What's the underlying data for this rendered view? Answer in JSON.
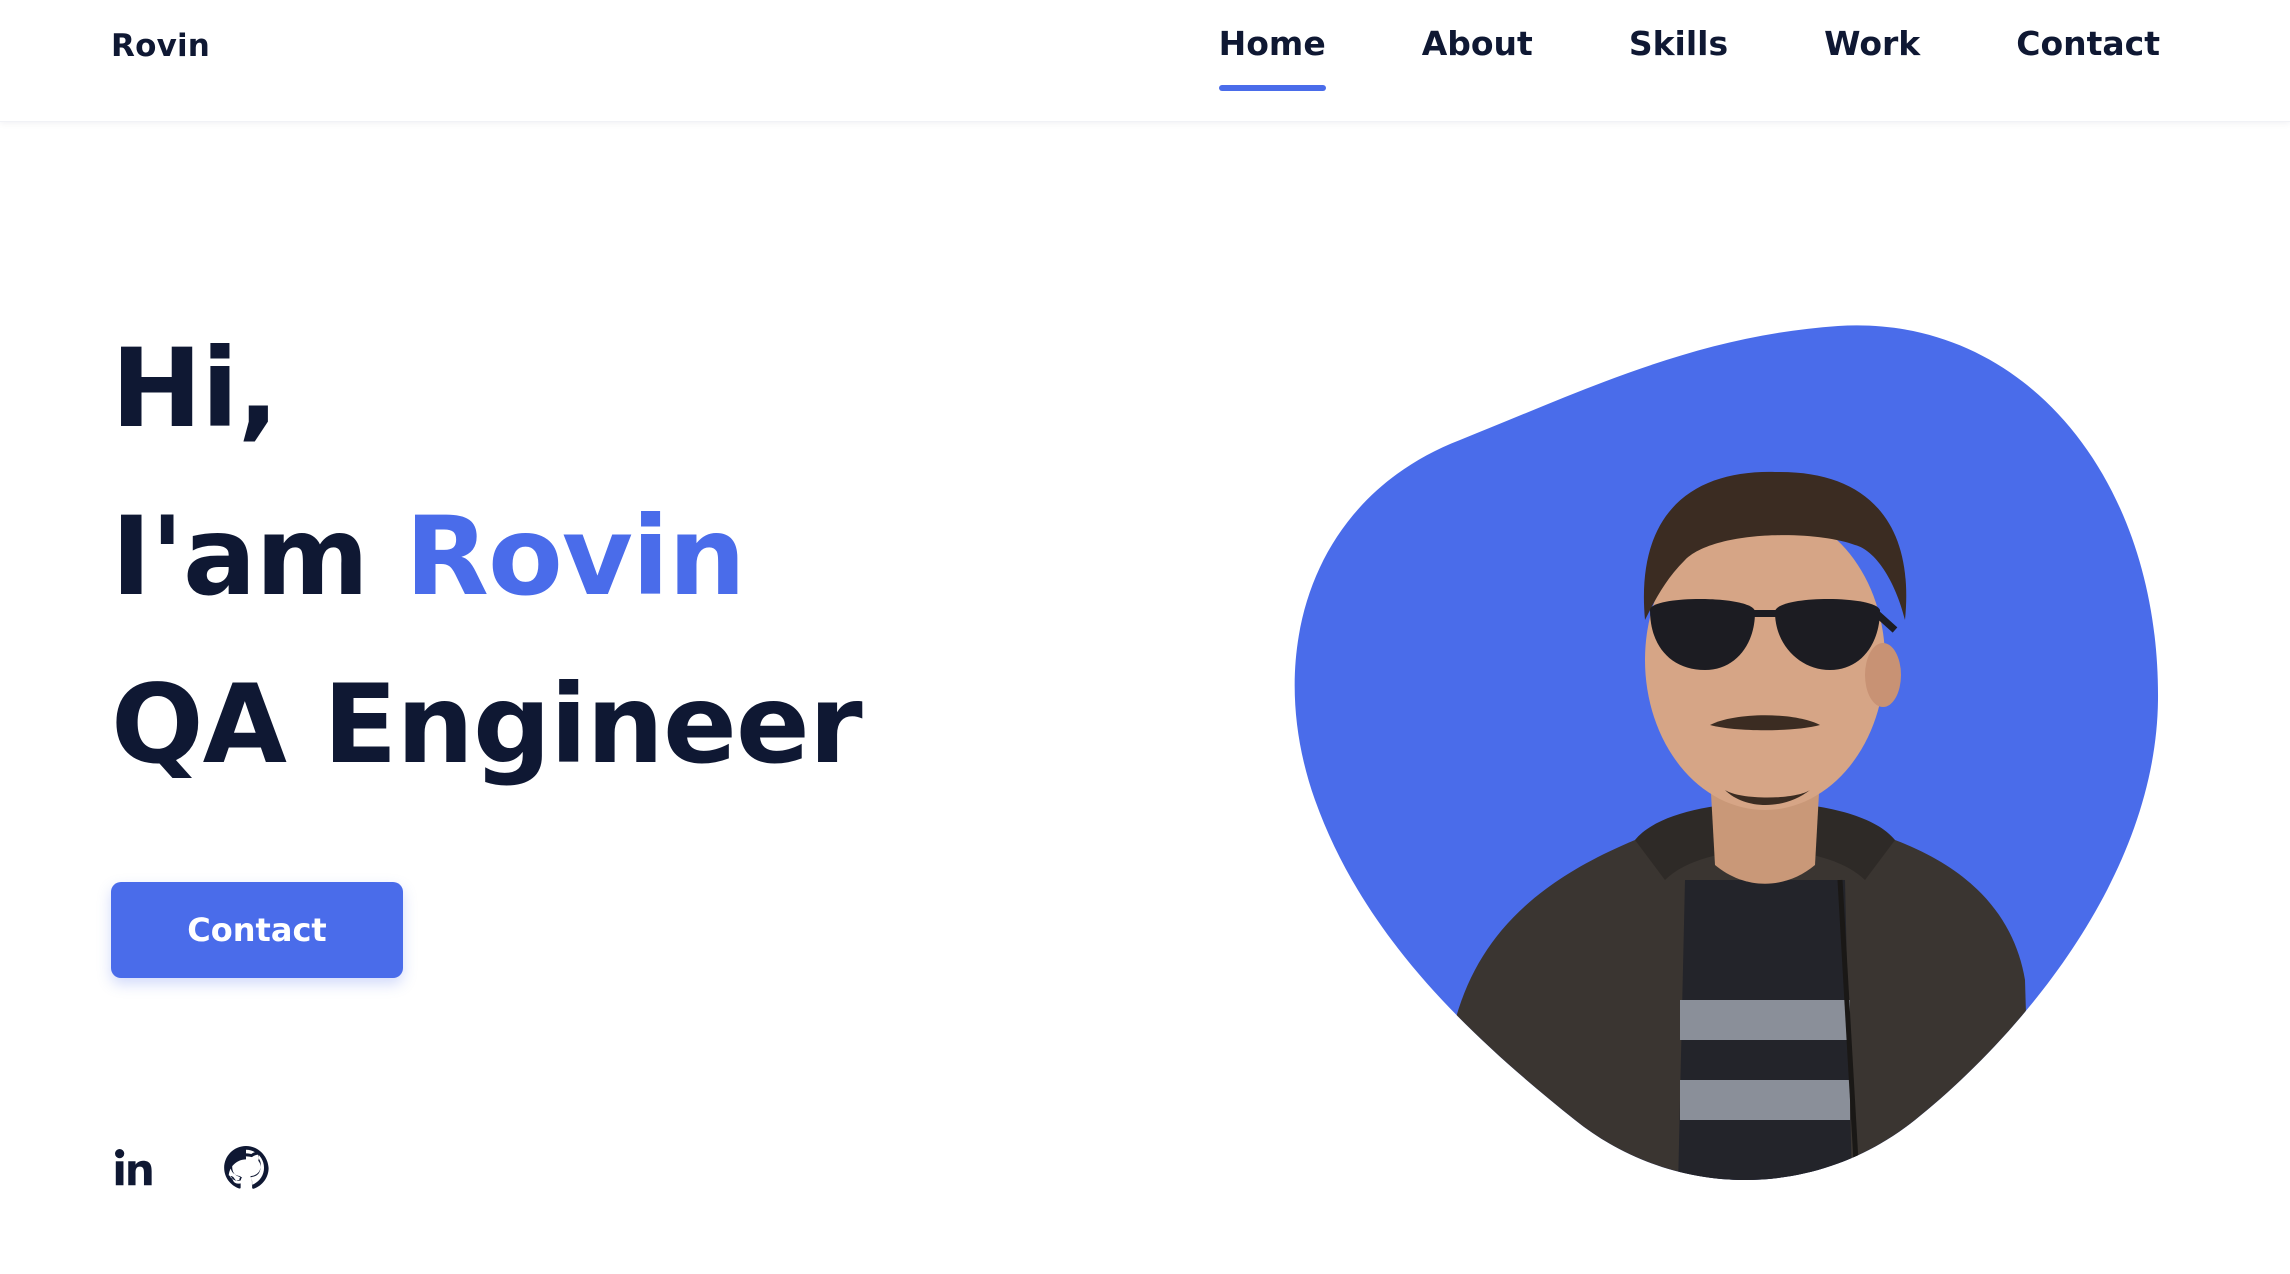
{
  "header": {
    "logo": "Rovin",
    "nav": [
      {
        "label": "Home",
        "active": true
      },
      {
        "label": "About",
        "active": false
      },
      {
        "label": "Skills",
        "active": false
      },
      {
        "label": "Work",
        "active": false
      },
      {
        "label": "Contact",
        "active": false
      }
    ]
  },
  "hero": {
    "line1": "Hi,",
    "line2_prefix": "I'am ",
    "line2_name": "Rovin",
    "line3": "QA Engineer",
    "button_label": "Contact"
  },
  "social": [
    {
      "icon": "linkedin-icon"
    },
    {
      "icon": "github-icon"
    }
  ],
  "colors": {
    "accent": "#4a6cea",
    "text": "#0f1833",
    "background": "#ffffff"
  }
}
